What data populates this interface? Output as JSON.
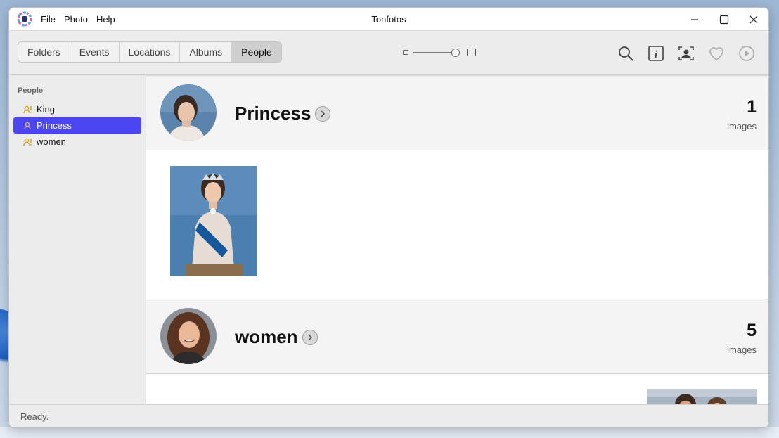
{
  "window": {
    "title": "Tonfotos",
    "menu": [
      "File",
      "Photo",
      "Help"
    ]
  },
  "toolbar": {
    "tabs": [
      {
        "label": "Folders",
        "active": false
      },
      {
        "label": "Events",
        "active": false
      },
      {
        "label": "Locations",
        "active": false
      },
      {
        "label": "Albums",
        "active": false
      },
      {
        "label": "People",
        "active": true
      }
    ],
    "icons": [
      "search-icon",
      "info-icon",
      "face-recognition-icon",
      "heart-icon",
      "play-icon"
    ]
  },
  "sidebar": {
    "heading": "People",
    "items": [
      {
        "label": "King",
        "selected": false
      },
      {
        "label": "Princess",
        "selected": true
      },
      {
        "label": "women",
        "selected": false
      }
    ]
  },
  "groups": [
    {
      "name": "Princess",
      "count": "1",
      "count_label": "images"
    },
    {
      "name": "women",
      "count": "5",
      "count_label": "images"
    }
  ],
  "status": {
    "text": "Ready."
  },
  "colors": {
    "selection": "#4b46f2",
    "person_icon": "#d4a21a"
  }
}
